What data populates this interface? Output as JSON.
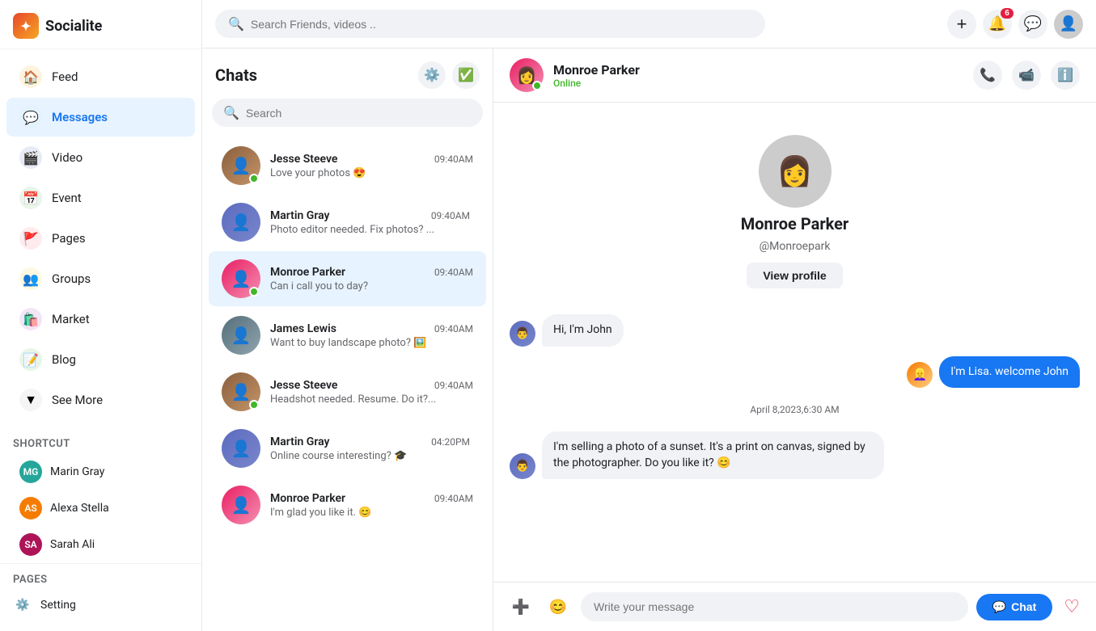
{
  "app": {
    "name": "Socialite",
    "logo_symbol": "✦"
  },
  "topbar": {
    "search_placeholder": "Search Friends, videos ..",
    "add_icon": "+",
    "notification_badge": "6",
    "notification_icon": "🔔",
    "message_icon": "💬"
  },
  "sidebar": {
    "nav_items": [
      {
        "id": "feed",
        "label": "Feed",
        "icon": "🏠",
        "icon_class": "feed",
        "active": false
      },
      {
        "id": "messages",
        "label": "Messages",
        "icon": "💬",
        "icon_class": "messages",
        "active": true
      },
      {
        "id": "video",
        "label": "Video",
        "icon": "🎬",
        "icon_class": "video",
        "active": false
      },
      {
        "id": "event",
        "label": "Event",
        "icon": "📅",
        "icon_class": "event",
        "active": false
      },
      {
        "id": "pages",
        "label": "Pages",
        "icon": "🚩",
        "icon_class": "pages",
        "active": false
      },
      {
        "id": "groups",
        "label": "Groups",
        "icon": "👥",
        "icon_class": "groups",
        "active": false
      },
      {
        "id": "market",
        "label": "Market",
        "icon": "🛍️",
        "icon_class": "market",
        "active": false
      },
      {
        "id": "blog",
        "label": "Blog",
        "icon": "📝",
        "icon_class": "blog",
        "active": false
      },
      {
        "id": "seemore",
        "label": "See More",
        "icon": "▼",
        "icon_class": "seemore",
        "active": false
      }
    ],
    "shortcut_label": "Shortcut",
    "shortcuts": [
      {
        "id": "marin-gray",
        "name": "Marin Gray",
        "initials": "MG",
        "color": "#26A69A"
      },
      {
        "id": "alexa-stella",
        "name": "Alexa Stella",
        "initials": "AS",
        "color": "#F57C00"
      },
      {
        "id": "sarah-ali",
        "name": "Sarah Ali",
        "initials": "SA",
        "color": "#AD1457"
      }
    ],
    "pages_label": "Pages",
    "setting_label": "Setting",
    "setting_icon": "⚙️"
  },
  "chats": {
    "title": "Chats",
    "search_placeholder": "Search",
    "items": [
      {
        "id": "jesse1",
        "name": "Jesse Steeve",
        "time": "09:40AM",
        "preview": "Love your photos 😍",
        "online": true,
        "unread": false,
        "avatar_class": "av-jesse"
      },
      {
        "id": "martin1",
        "name": "Martin Gray",
        "time": "09:40AM",
        "preview": "Photo editor needed. Fix photos? ...",
        "online": false,
        "unread": true,
        "avatar_class": "av-martin"
      },
      {
        "id": "monroe1",
        "name": "Monroe Parker",
        "time": "09:40AM",
        "preview": "Can i call you to day?",
        "online": true,
        "unread": false,
        "avatar_class": "av-monroe",
        "active": true
      },
      {
        "id": "james1",
        "name": "James Lewis",
        "time": "09:40AM",
        "preview": "Want to buy landscape photo? 🖼️",
        "online": false,
        "unread": false,
        "avatar_class": "av-james"
      },
      {
        "id": "jesse2",
        "name": "Jesse Steeve",
        "time": "09:40AM",
        "preview": "Headshot needed. Resume. Do it?...",
        "online": true,
        "unread": false,
        "avatar_class": "av-jesse"
      },
      {
        "id": "martin2",
        "name": "Martin Gray",
        "time": "04:20PM",
        "preview": "Online course interesting? 🎓",
        "online": false,
        "unread": true,
        "avatar_class": "av-martin"
      },
      {
        "id": "monroe2",
        "name": "Monroe Parker",
        "time": "09:40AM",
        "preview": "I'm glad you like it. 😊",
        "online": false,
        "unread": false,
        "avatar_class": "av-monroe"
      }
    ]
  },
  "chat_window": {
    "contact_name": "Monroe Parker",
    "contact_handle": "@Monroepark",
    "contact_status": "Online",
    "view_profile_label": "View profile",
    "profile_avatar_emoji": "👩",
    "messages": [
      {
        "id": "msg1",
        "type": "received",
        "text": "Hi, I'm John",
        "avatar_emoji": "👨"
      },
      {
        "id": "msg2",
        "type": "sent",
        "text": "I'm Lisa. welcome John",
        "avatar_emoji": "👱‍♀️"
      }
    ],
    "date_divider": "April 8,2023,6:30 AM",
    "long_message": {
      "type": "received",
      "text": "I'm selling a photo of a sunset. It's a print on canvas, signed by the photographer. Do you like it? 😊",
      "avatar_emoji": "👨"
    },
    "input_placeholder": "Write your message",
    "send_label": "Chat",
    "send_icon": "💬"
  }
}
